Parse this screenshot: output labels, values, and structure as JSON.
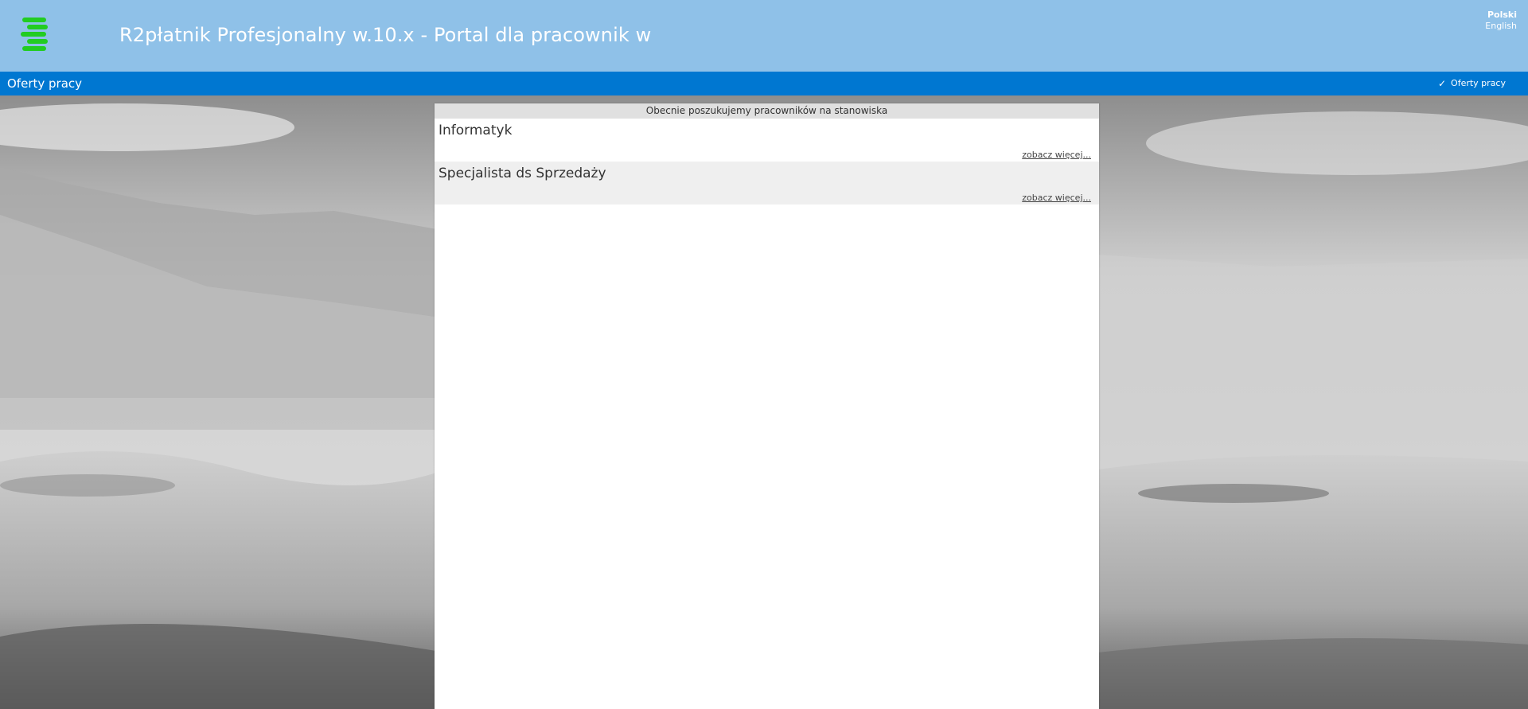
{
  "header": {
    "title": "R2płatnik Profesjonalny w.10.x - Portal dla pracownik w",
    "logo_icon": "stacked-bars-logo-icon",
    "languages": [
      "Polski",
      "English"
    ],
    "active_language": "Polski"
  },
  "navbar": {
    "title": "Oferty pracy",
    "right_item": {
      "icon": "check-icon",
      "label": "Oferty pracy"
    }
  },
  "panel": {
    "heading": "Obecnie poszukujemy pracowników na stanowiska",
    "jobs": [
      {
        "title": "Informatyk",
        "more_link": "zobacz więcej..."
      },
      {
        "title": "Specjalista ds Sprzedaży",
        "more_link": "zobacz więcej..."
      }
    ]
  },
  "colors": {
    "header_bg": "#8fc1e8",
    "navbar_bg": "#0077d1",
    "logo_green": "#22cc22",
    "panel_header_bg": "#e0e0e0"
  }
}
